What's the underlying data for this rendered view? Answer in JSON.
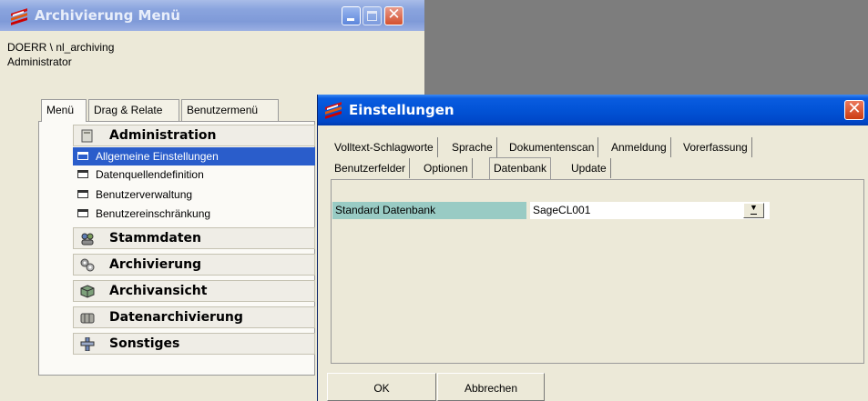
{
  "menu_window": {
    "title": "Archivierung Menü",
    "user": "DOERR \\ nl_archiving",
    "role": "Administrator",
    "tabs": [
      {
        "label": "Menü",
        "active": true
      },
      {
        "label": "Drag & Relate",
        "active": false
      },
      {
        "label": "Benutzermenü",
        "active": false
      }
    ],
    "sections": [
      {
        "label": "Administration",
        "icon": "folder-icon",
        "expanded": true,
        "items": [
          {
            "label": "Allgemeine Einstellungen",
            "selected": true
          },
          {
            "label": "Datenquellendefinition",
            "selected": false
          },
          {
            "label": "Benutzerverwaltung",
            "selected": false
          },
          {
            "label": "Benutzereinschränkung",
            "selected": false
          }
        ]
      },
      {
        "label": "Stammdaten",
        "icon": "people-icon",
        "expanded": false
      },
      {
        "label": "Archivierung",
        "icon": "gears-icon",
        "expanded": false
      },
      {
        "label": "Archivansicht",
        "icon": "cube-icon",
        "expanded": false
      },
      {
        "label": "Datenarchivierung",
        "icon": "storage-icon",
        "expanded": false
      },
      {
        "label": "Sonstiges",
        "icon": "tools-icon",
        "expanded": false
      }
    ]
  },
  "settings_window": {
    "title": "Einstellungen",
    "tabs_row1": [
      {
        "label": "Volltext-Schlagworte"
      },
      {
        "label": "Sprache"
      },
      {
        "label": "Dokumentenscan"
      },
      {
        "label": "Anmeldung"
      },
      {
        "label": "Vorerfassung"
      }
    ],
    "tabs_row2": [
      {
        "label": "Benutzerfelder",
        "active": false
      },
      {
        "label": "Optionen",
        "active": false
      },
      {
        "label": "Datenbank",
        "active": true
      },
      {
        "label": "Update",
        "active": false
      }
    ],
    "field": {
      "label": "Standard Datenbank",
      "value": "SageCL001"
    },
    "buttons": {
      "ok": "OK",
      "cancel": "Abbrechen"
    }
  },
  "colors": {
    "active_titlebar": "#0253d6",
    "inactive_titlebar": "#8aa4de",
    "selection": "#2a5dcb",
    "field_label_bg": "#99cbc4",
    "close_button": "#d4502e"
  }
}
